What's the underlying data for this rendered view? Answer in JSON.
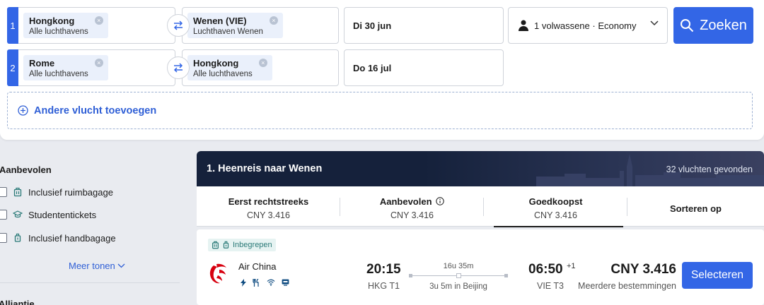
{
  "search": {
    "legs": [
      {
        "number": "1",
        "origin_city": "Hongkong",
        "origin_sub": "Alle luchthavens",
        "dest_city": "Wenen (VIE)",
        "dest_sub": "Luchthaven Wenen",
        "date": "Di 30 jun"
      },
      {
        "number": "2",
        "origin_city": "Rome",
        "origin_sub": "Alle luchthavens",
        "dest_city": "Hongkong",
        "dest_sub": "Alle luchthavens",
        "date": "Do 16 jul"
      }
    ],
    "clear_glyph": "×",
    "passengers": "1 volwassene · Economy",
    "search_label": "Zoeken",
    "add_flight_label": "Andere vlucht toevoegen",
    "accent_color": "#3366e6"
  },
  "filters": {
    "section_title": "Aanbevolen",
    "items": [
      {
        "label": "Inclusief ruimbagage",
        "icon": "luggage-icon"
      },
      {
        "label": "Studententickets",
        "icon": "graduation-cap-icon"
      },
      {
        "label": "Inclusief handbagage",
        "icon": "carry-on-icon"
      }
    ],
    "more_label": "Meer tonen",
    "next_section_title": "Alliantie"
  },
  "results": {
    "header_title": "1. Heenreis naar Wenen",
    "count_text": "32 vluchten gevonden",
    "sort_tabs": [
      {
        "label": "Eerst rechtstreeks",
        "price": "CNY 3.416"
      },
      {
        "label": "Aanbevolen",
        "price": "CNY 3.416"
      },
      {
        "label": "Goedkoopst",
        "price": "CNY 3.416",
        "active": true
      },
      {
        "label": "Sorteren op"
      }
    ],
    "flight": {
      "badge": "Inbegrepen",
      "airline": "Air China",
      "amenities": [
        "lightning-icon",
        "meal-icon",
        "wifi-icon",
        "screen-icon"
      ],
      "dep_time": "20:15",
      "dep_airport": "HKG T1",
      "duration": "16u 35m",
      "stop_info": "3u 5m in Beijing",
      "arr_time": "06:50",
      "arr_day_offset": "+1",
      "arr_airport": "VIE T3",
      "price": "CNY 3.416",
      "price_note": "Meerdere bestemmingen",
      "select_label": "Selecteren"
    }
  }
}
